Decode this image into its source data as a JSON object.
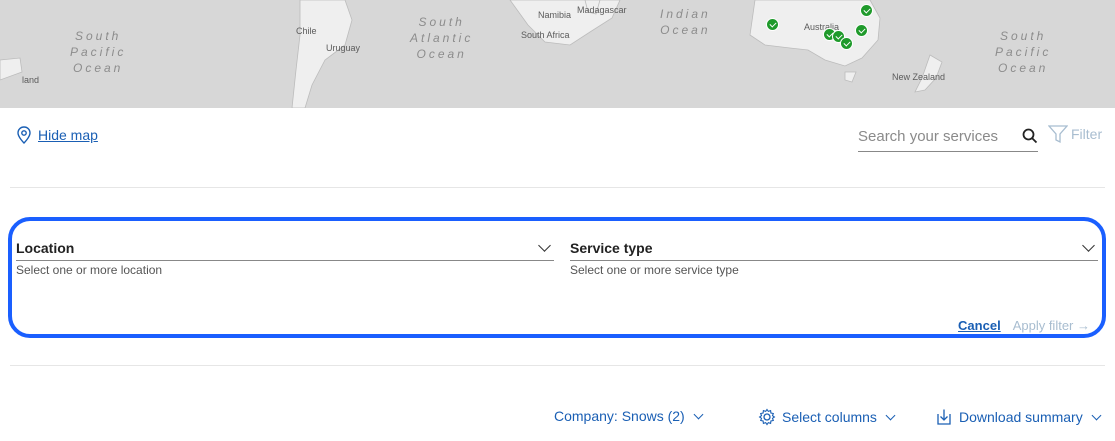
{
  "map": {
    "oceans": [
      {
        "name": "South\nPacific\nOcean"
      },
      {
        "name": "South\nAtlantic\nOcean"
      },
      {
        "name": "Indian\nOcean"
      },
      {
        "name": "South\nPacific\nOcean"
      }
    ],
    "places": [
      "land",
      "Chile",
      "Uruguay",
      "Namibia",
      "Madagascar",
      "South Africa",
      "Australia",
      "New Zealand"
    ],
    "pin_count": 6
  },
  "map_toggle": {
    "label": "Hide map",
    "icon": "location-pin-icon"
  },
  "search": {
    "placeholder": "Search your services",
    "icon": "search-icon"
  },
  "filter": {
    "label": "Filter",
    "icon": "filter-funnel-icon"
  },
  "panel": {
    "location": {
      "label": "Location",
      "hint": "Select one or more location"
    },
    "service_type": {
      "label": "Service type",
      "hint": "Select one or more service type"
    },
    "cancel_label": "Cancel",
    "apply_label": "Apply filter →"
  },
  "toolbar": {
    "company": "Company: Snows (2)",
    "select_columns": "Select columns",
    "download": "Download summary"
  },
  "colors": {
    "accent": "#1a5fb4",
    "panel_border": "#1a5fff",
    "pin": "#1f9a2b"
  }
}
